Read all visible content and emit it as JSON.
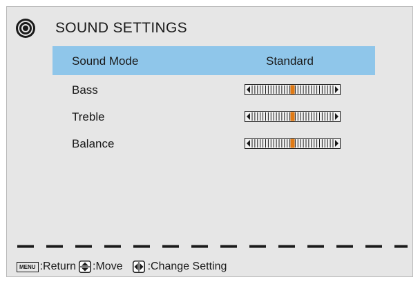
{
  "header": {
    "icon": "speaker-icon",
    "title": "SOUND SETTINGS"
  },
  "menu": {
    "selected_item": {
      "label": "Sound Mode",
      "value": "Standard"
    },
    "sliders": [
      {
        "label": "Bass",
        "level": 0.5
      },
      {
        "label": "Treble",
        "level": 0.5
      },
      {
        "label": "Balance",
        "level": 0.5
      }
    ]
  },
  "footer": {
    "menu_key": "MENU",
    "return_label": ":Return",
    "move_label": ":Move",
    "change_label": ":Change Setting"
  },
  "colors": {
    "background": "#e6e6e6",
    "highlight": "#8fc6ea",
    "slider_marker": "#e07a14",
    "text": "#1a1a1a"
  }
}
